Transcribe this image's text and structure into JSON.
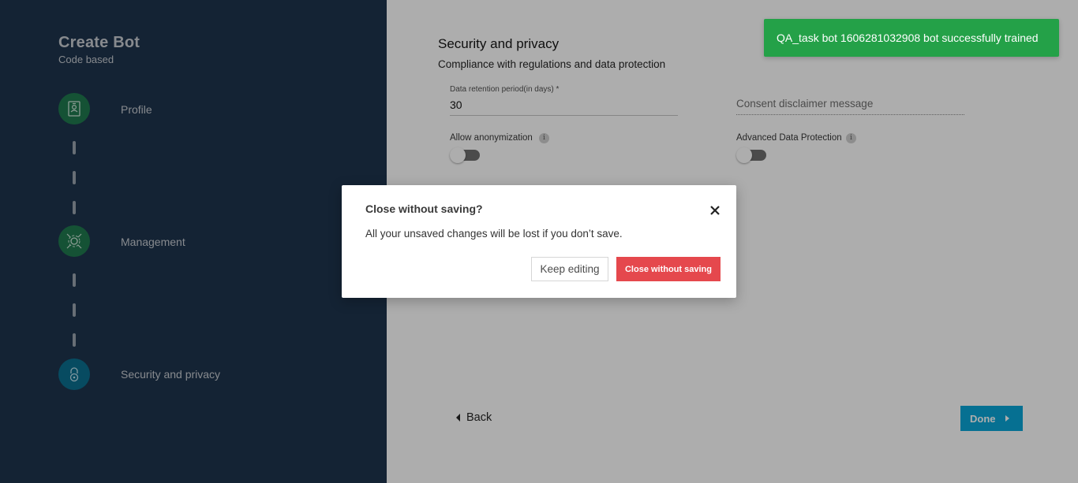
{
  "sidebar": {
    "title": "Create Bot",
    "subtitle": "Code based",
    "steps": [
      {
        "label": "Profile",
        "icon": "id-badge-icon",
        "color": "#1f7a4f"
      },
      {
        "label": "Management",
        "icon": "gear-network-icon",
        "color": "#1f7a4f"
      },
      {
        "label": "Security and privacy",
        "icon": "lock-icon",
        "color": "#0b6f8f"
      }
    ]
  },
  "main": {
    "title": "Security and privacy",
    "subtitle": "Compliance with regulations and data protection",
    "retention": {
      "label": "Data retention period(in days) *",
      "value": "30"
    },
    "consent": {
      "placeholder": "Consent disclaimer message"
    },
    "anonymization": {
      "label": "Allow anonymization",
      "enabled": false
    },
    "advanced_protection": {
      "label": "Advanced Data Protection",
      "enabled": false
    },
    "back_label": "Back",
    "done_label": "Done"
  },
  "modal": {
    "title": "Close without saving?",
    "message": "All your unsaved changes will be lost if you don’t save.",
    "keep_label": "Keep editing",
    "close_label": "Close without saving"
  },
  "toast": {
    "message": "QA_task bot 1606281032908 bot successfully trained",
    "color": "#24a148"
  }
}
